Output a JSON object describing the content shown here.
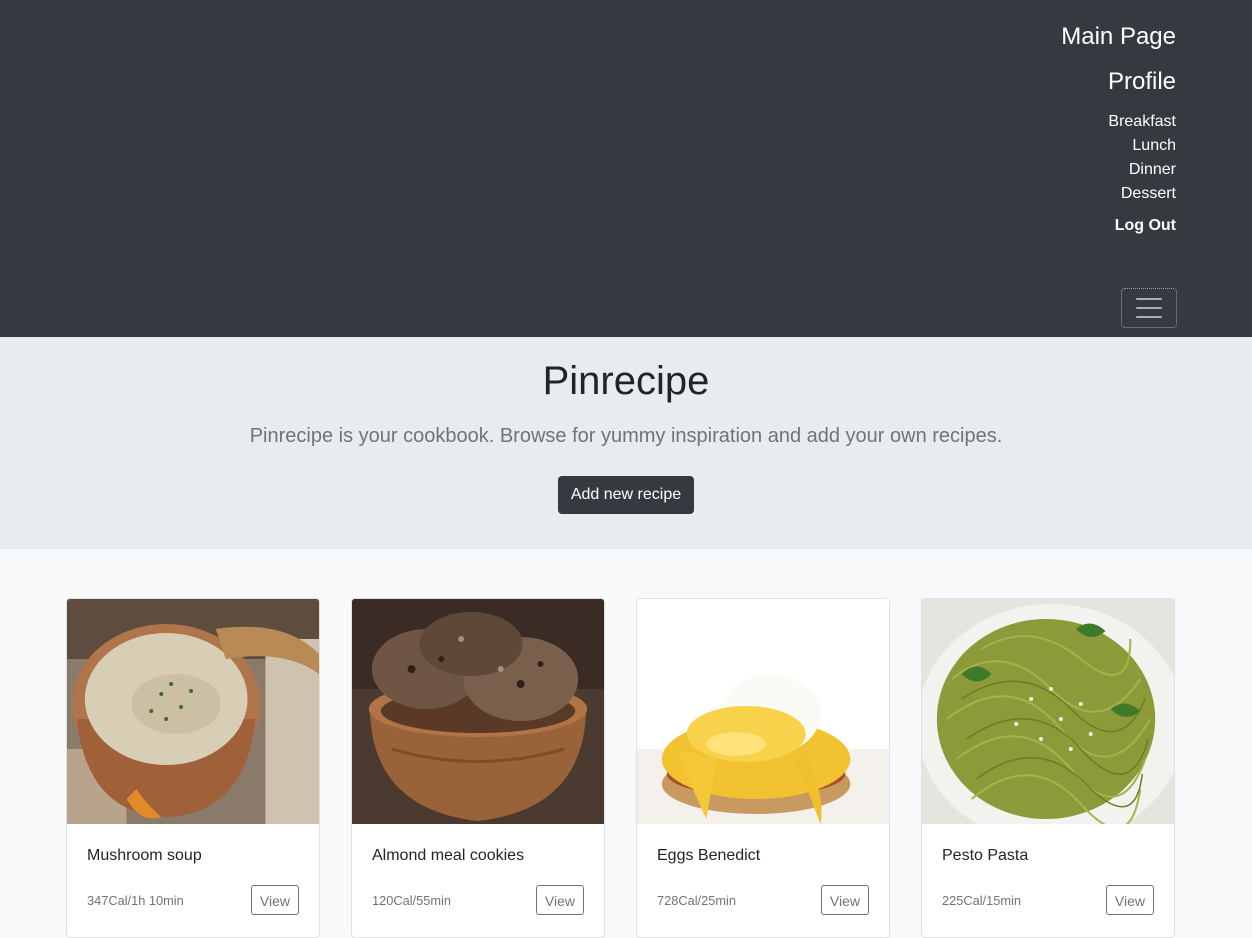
{
  "nav": {
    "main_page": "Main Page",
    "profile": "Profile",
    "categories": [
      "Breakfast",
      "Lunch",
      "Dinner",
      "Dessert"
    ],
    "logout": "Log Out",
    "toggler_icon": "hamburger-menu-icon"
  },
  "hero": {
    "title": "Pinrecipe",
    "subtitle": "Pinrecipe is your cookbook. Browse for yummy inspiration and add your own recipes.",
    "add_button": "Add new recipe"
  },
  "recipes": [
    {
      "name": "Mushroom soup",
      "meta": "347Cal/1h 10min",
      "view": "View",
      "image": "mushroom-soup-image"
    },
    {
      "name": "Almond meal cookies",
      "meta": "120Cal/55min",
      "view": "View",
      "image": "almond-cookies-image"
    },
    {
      "name": "Eggs Benedict",
      "meta": "728Cal/25min",
      "view": "View",
      "image": "eggs-benedict-image"
    },
    {
      "name": "Pesto Pasta",
      "meta": "225Cal/15min",
      "view": "View",
      "image": "pesto-pasta-image"
    }
  ],
  "colors": {
    "navbar": "#343a40",
    "hero_bg": "#e9ecef",
    "page_bg": "#f8f9fa",
    "button_dark": "#343a40",
    "muted": "#6c757d"
  }
}
